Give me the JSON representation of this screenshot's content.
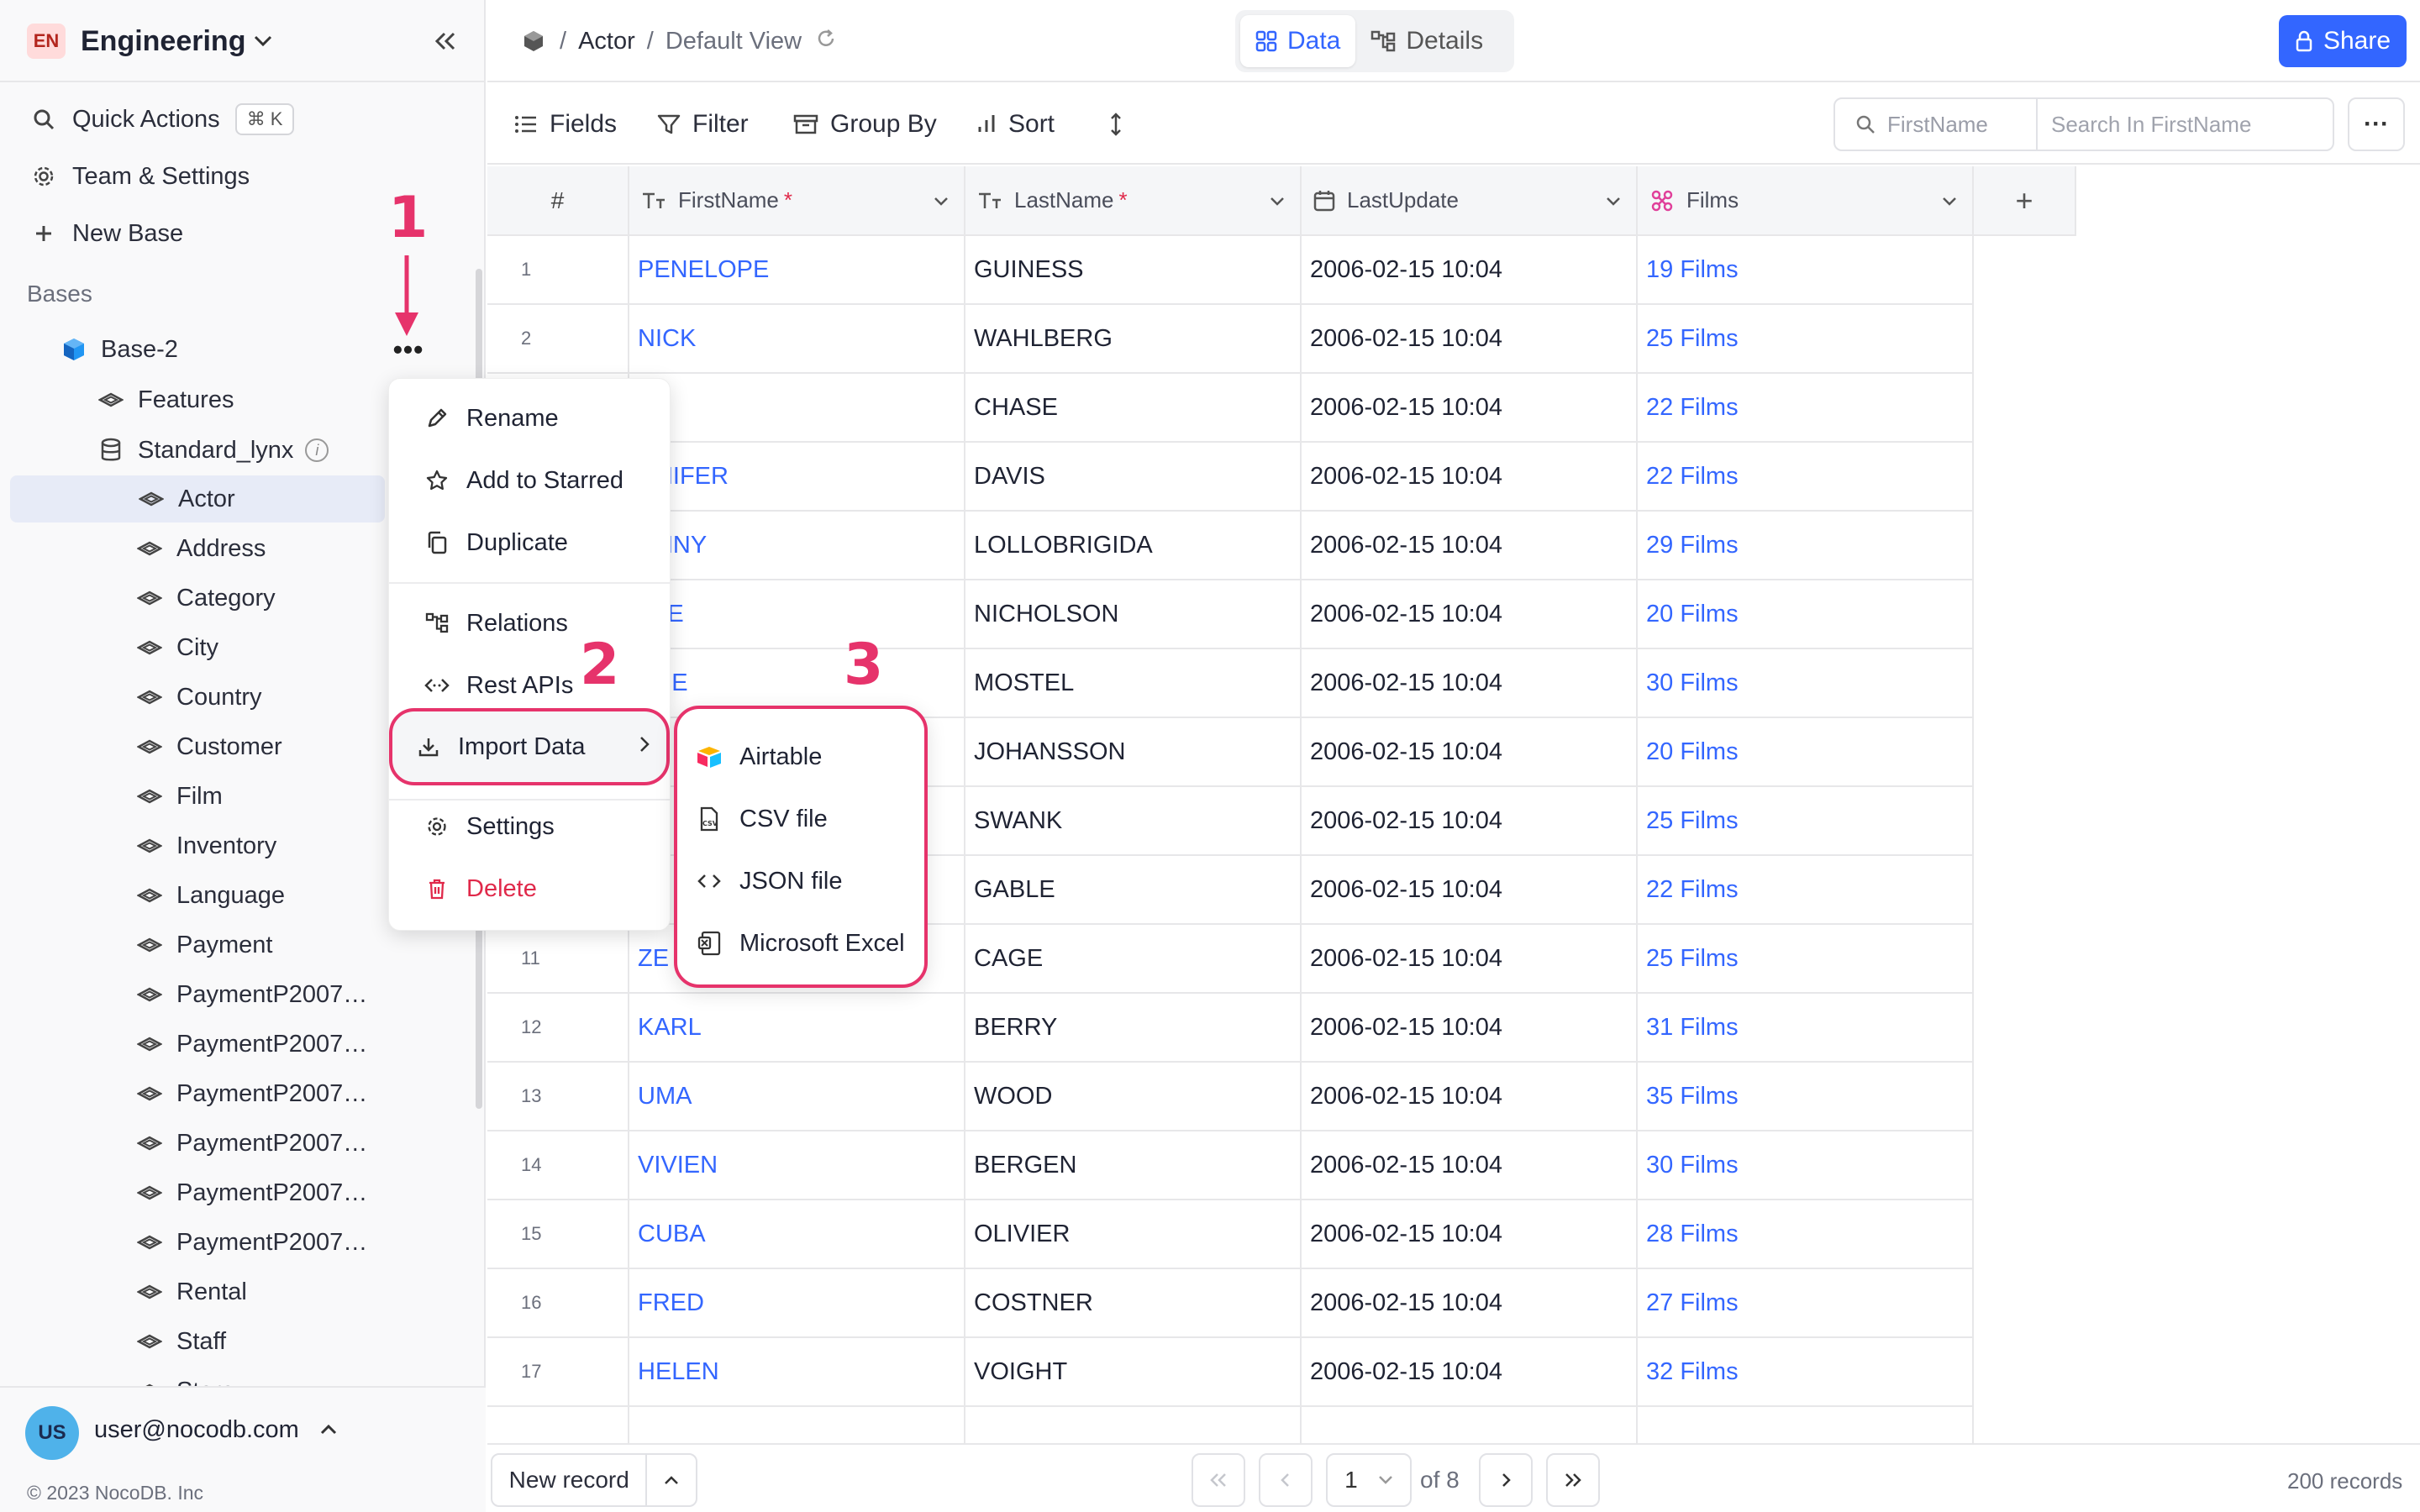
{
  "workspace": {
    "badge": "EN",
    "name": "Engineering"
  },
  "sidebar": {
    "quick_actions": {
      "label": "Quick Actions",
      "shortcut": "⌘ K"
    },
    "team_settings": "Team & Settings",
    "new_base": "New Base",
    "section_label": "Bases",
    "base": {
      "name": "Base-2"
    },
    "features": "Features",
    "source": "Standard_lynx",
    "tables": [
      "Actor",
      "Address",
      "Category",
      "City",
      "Country",
      "Customer",
      "Film",
      "Inventory",
      "Language",
      "Payment",
      "PaymentP2007…",
      "PaymentP2007…",
      "PaymentP2007…",
      "PaymentP2007…",
      "PaymentP2007…",
      "PaymentP2007…",
      "Rental",
      "Staff",
      "Store"
    ],
    "active_table": "Actor"
  },
  "user": {
    "badge": "US",
    "email": "user@nocodb.com",
    "copyright": "© 2023 NocoDB. Inc"
  },
  "topbar": {
    "breadcrumb_table": "Actor",
    "breadcrumb_view": "Default View",
    "separator": "/",
    "tabs": [
      {
        "label": "Data",
        "active": true
      },
      {
        "label": "Details",
        "active": false
      }
    ],
    "share_label": "Share"
  },
  "toolbar": {
    "fields": "Fields",
    "filter": "Filter",
    "group_by": "Group By",
    "sort": "Sort",
    "search_field": "FirstName",
    "search_placeholder": "Search In FirstName",
    "more": "···"
  },
  "grid": {
    "columns": [
      {
        "label": "#"
      },
      {
        "label": "FirstName",
        "required": "*"
      },
      {
        "label": "LastName",
        "required": "*"
      },
      {
        "label": "LastUpdate"
      },
      {
        "label": "Films"
      }
    ],
    "add_column": "+",
    "rows": [
      {
        "n": "1",
        "first": "PENELOPE",
        "last": "GUINESS",
        "updated": "2006-02-15 10:04",
        "films": "19 Films"
      },
      {
        "n": "2",
        "first": "NICK",
        "last": "WAHLBERG",
        "updated": "2006-02-15 10:04",
        "films": "25 Films"
      },
      {
        "n": "",
        "first": "",
        "last": "CHASE",
        "updated": "2006-02-15 10:04",
        "films": "22 Films"
      },
      {
        "n": "",
        "first": "NNIFER",
        "last": "DAVIS",
        "updated": "2006-02-15 10:04",
        "films": "22 Films"
      },
      {
        "n": "",
        "first": "HNNY",
        "last": "LOLLOBRIGIDA",
        "updated": "2006-02-15 10:04",
        "films": "29 Films"
      },
      {
        "n": "",
        "first": "TTE",
        "last": "NICHOLSON",
        "updated": "2006-02-15 10:04",
        "films": "20 Films"
      },
      {
        "n": "",
        "first": "ACE",
        "last": "MOSTEL",
        "updated": "2006-02-15 10:04",
        "films": "30 Films"
      },
      {
        "n": "",
        "first": "",
        "last": "JOHANSSON",
        "updated": "2006-02-15 10:04",
        "films": "20 Films"
      },
      {
        "n": "",
        "first": "",
        "last": "SWANK",
        "updated": "2006-02-15 10:04",
        "films": "25 Films"
      },
      {
        "n": "",
        "first": "",
        "last": "GABLE",
        "updated": "2006-02-15 10:04",
        "films": "22 Films"
      },
      {
        "n": "11",
        "first": "ZE",
        "last": "CAGE",
        "updated": "2006-02-15 10:04",
        "films": "25 Films"
      },
      {
        "n": "12",
        "first": "KARL",
        "last": "BERRY",
        "updated": "2006-02-15 10:04",
        "films": "31 Films"
      },
      {
        "n": "13",
        "first": "UMA",
        "last": "WOOD",
        "updated": "2006-02-15 10:04",
        "films": "35 Films"
      },
      {
        "n": "14",
        "first": "VIVIEN",
        "last": "BERGEN",
        "updated": "2006-02-15 10:04",
        "films": "30 Films"
      },
      {
        "n": "15",
        "first": "CUBA",
        "last": "OLIVIER",
        "updated": "2006-02-15 10:04",
        "films": "28 Films"
      },
      {
        "n": "16",
        "first": "FRED",
        "last": "COSTNER",
        "updated": "2006-02-15 10:04",
        "films": "27 Films"
      },
      {
        "n": "17",
        "first": "HELEN",
        "last": "VOIGHT",
        "updated": "2006-02-15 10:04",
        "films": "32 Films"
      }
    ]
  },
  "footer": {
    "new_record": "New record",
    "page": "1",
    "of_pages": "of 8",
    "records": "200 records"
  },
  "context_menu": {
    "rename": "Rename",
    "add_starred": "Add to Starred",
    "duplicate": "Duplicate",
    "relations": "Relations",
    "rest_apis": "Rest APIs",
    "import_data": "Import Data",
    "settings": "Settings",
    "delete": "Delete"
  },
  "import_submenu": {
    "airtable": "Airtable",
    "csv": "CSV file",
    "json": "JSON file",
    "excel": "Microsoft Excel"
  },
  "annotations": [
    "1",
    "2",
    "3"
  ],
  "colors": {
    "accent": "#3366ff",
    "annotation": "#e6336b",
    "danger": "#e0294a"
  }
}
